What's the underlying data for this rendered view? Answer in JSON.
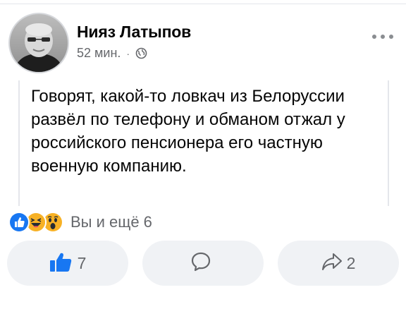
{
  "post": {
    "author": "Нияз Латыпов",
    "time": "52 мин.",
    "separator": "·",
    "privacy_icon": "globe-icon",
    "text": "Говорят, какой-то ловкач из Белоруссии развёл по телефону и обманом отжал у российского пенсионера его частную военную компанию."
  },
  "reactions": {
    "icons": [
      "like-reaction-icon",
      "haha-reaction-icon",
      "wow-reaction-icon"
    ],
    "summary": "Вы и ещё 6"
  },
  "actions": {
    "like_count": "7",
    "comment_count": "",
    "share_count": "2"
  },
  "colors": {
    "accent_blue": "#1877f2",
    "muted_text": "#65676b",
    "button_bg": "#f0f2f5",
    "reaction_yellow": "#f7b125"
  }
}
